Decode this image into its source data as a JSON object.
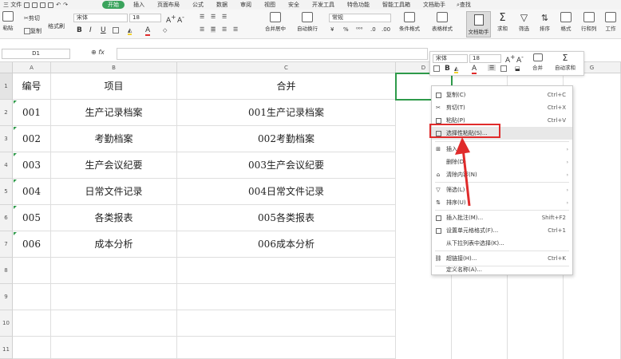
{
  "menubar": {
    "file_label": "三 文件",
    "tabs": [
      "开始",
      "插入",
      "页面布局",
      "公式",
      "数据",
      "审阅",
      "视图",
      "安全",
      "开发工具",
      "特色功能",
      "智能工具箱",
      "文档助手"
    ],
    "active_tab": "开始",
    "search_label": "查找"
  },
  "ribbon": {
    "paste_label": "粘贴",
    "cut_label": "剪切",
    "copy_label": "复制",
    "format_painter_label": "格式刷",
    "font_name": "宋体",
    "font_size": "18",
    "bold": "B",
    "italic": "I",
    "underline": "U",
    "number_format": "常规",
    "merge_center_label": "合并居中",
    "wrap_label": "自动换行",
    "cond_format_label": "条件格式",
    "table_style_label": "表格样式",
    "doc_helper_label": "文档助手",
    "sum_label": "求和",
    "filter_label": "筛选",
    "sort_label": "排序",
    "format_label": "格式",
    "rowcol_label": "行和列",
    "worksheet_label": "工作"
  },
  "formula_bar": {
    "name_box": "D1",
    "fx": "fx"
  },
  "sheet": {
    "columns": [
      "A",
      "B",
      "C",
      "D",
      "G"
    ],
    "rows": [
      "1",
      "2",
      "3",
      "4",
      "5",
      "6",
      "7",
      "8",
      "9",
      "10",
      "11"
    ],
    "data": [
      [
        "编号",
        "项目",
        "合并"
      ],
      [
        "001",
        "生产记录档案",
        "001生产记录档案"
      ],
      [
        "002",
        "考勤档案",
        "002考勤档案"
      ],
      [
        "003",
        "生产会议纪要",
        "003生产会议纪要"
      ],
      [
        "004",
        "日常文件记录",
        "004日常文件记录"
      ],
      [
        "005",
        "各类报表",
        "005各类报表"
      ],
      [
        "006",
        "成本分析",
        "006成本分析"
      ]
    ]
  },
  "mini_toolbar": {
    "font_name": "宋体",
    "font_size": "18",
    "bold": "B",
    "merge_label": "合并",
    "autosum_label": "自动求和"
  },
  "context_menu": {
    "items": [
      {
        "label": "复制(C)",
        "shortcut": "Ctrl+C",
        "icon": "copy-icon"
      },
      {
        "label": "剪切(T)",
        "shortcut": "Ctrl+X",
        "icon": "scissors-icon"
      },
      {
        "label": "粘贴(P)",
        "shortcut": "Ctrl+V",
        "icon": "paste-icon"
      },
      {
        "label": "选择性粘贴(S)...",
        "shortcut": "",
        "icon": "paste-special-icon"
      },
      {
        "label": "插入(I)",
        "shortcut": "",
        "icon": "insert-icon",
        "submenu": true
      },
      {
        "label": "删除(D)",
        "shortcut": "",
        "icon": "",
        "submenu": true
      },
      {
        "label": "清除内容(N)",
        "shortcut": "",
        "icon": "eraser-icon",
        "submenu": true
      },
      {
        "label": "筛选(L)",
        "shortcut": "",
        "icon": "filter-icon",
        "submenu": true
      },
      {
        "label": "排序(U)",
        "shortcut": "",
        "icon": "sort-icon",
        "submenu": true
      },
      {
        "label": "插入批注(M)...",
        "shortcut": "Shift+F2",
        "icon": "comment-icon"
      },
      {
        "label": "设置单元格格式(F)...",
        "shortcut": "Ctrl+1",
        "icon": "format-cells-icon"
      },
      {
        "label": "从下拉列表中选择(K)...",
        "shortcut": "",
        "icon": ""
      },
      {
        "label": "超链接(H)...",
        "shortcut": "Ctrl+K",
        "icon": "link-icon"
      },
      {
        "label": "定义名称(A)...",
        "shortcut": "",
        "icon": ""
      }
    ]
  },
  "colors": {
    "accent_green": "#2e9a4a",
    "highlight_red": "#e02b2b"
  }
}
